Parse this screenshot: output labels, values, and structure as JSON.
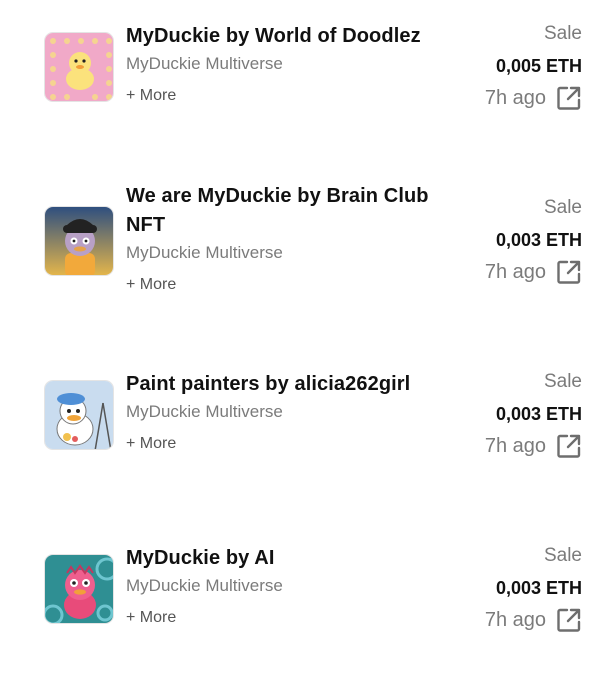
{
  "activity": [
    {
      "title": "MyDuckie by World of Doodlez",
      "collection": "MyDuckie Multiverse",
      "more": "+ More",
      "event": "Sale",
      "price": "0,005 ETH",
      "time": "7h ago",
      "thumb_bg": "#f1a9c8",
      "link_icon": "external-link-icon"
    },
    {
      "title": "We are MyDuckie by Brain Club NFT",
      "collection": "MyDuckie Multiverse",
      "more": "+ More",
      "event": "Sale",
      "price": "0,003 ETH",
      "time": "7h ago",
      "thumb_bg": "#e3b54a",
      "link_icon": "external-link-icon"
    },
    {
      "title": "Paint painters by alicia262girl",
      "collection": "MyDuckie Multiverse",
      "more": "+ More",
      "event": "Sale",
      "price": "0,003 ETH",
      "time": "7h ago",
      "thumb_bg": "#c9dcef",
      "link_icon": "external-link-icon"
    },
    {
      "title": "MyDuckie by AI",
      "collection": "MyDuckie Multiverse",
      "more": "+ More",
      "event": "Sale",
      "price": "0,003 ETH",
      "time": "7h ago",
      "thumb_bg": "#2f8f93",
      "link_icon": "external-link-icon"
    }
  ],
  "colors": {
    "title": "#111111",
    "muted": "#7b7b7b",
    "icon": "#6e6e6e"
  }
}
